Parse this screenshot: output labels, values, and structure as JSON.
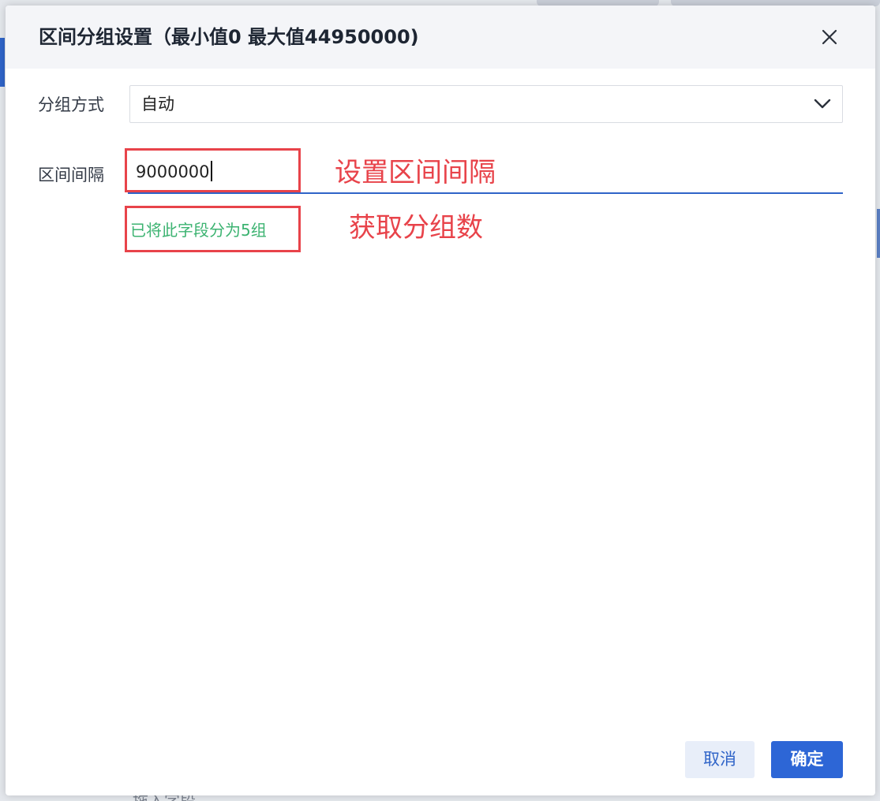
{
  "dialog": {
    "title": "区间分组设置（最小值0 最大值44950000)",
    "close_icon": "close-icon"
  },
  "form": {
    "mode_label": "分组方式",
    "mode_value": "自动",
    "interval_label": "区间间隔",
    "interval_value": "9000000",
    "hint": "已将此字段分为5组"
  },
  "annotations": {
    "set_interval": "设置区间间隔",
    "get_group_count": "获取分组数"
  },
  "buttons": {
    "cancel": "取消",
    "ok": "确定"
  },
  "background": {
    "bottom_text": "拖入字段"
  },
  "colors": {
    "accent": "#2f64c8",
    "annotation": "#e8434a",
    "success": "#3cb371"
  }
}
